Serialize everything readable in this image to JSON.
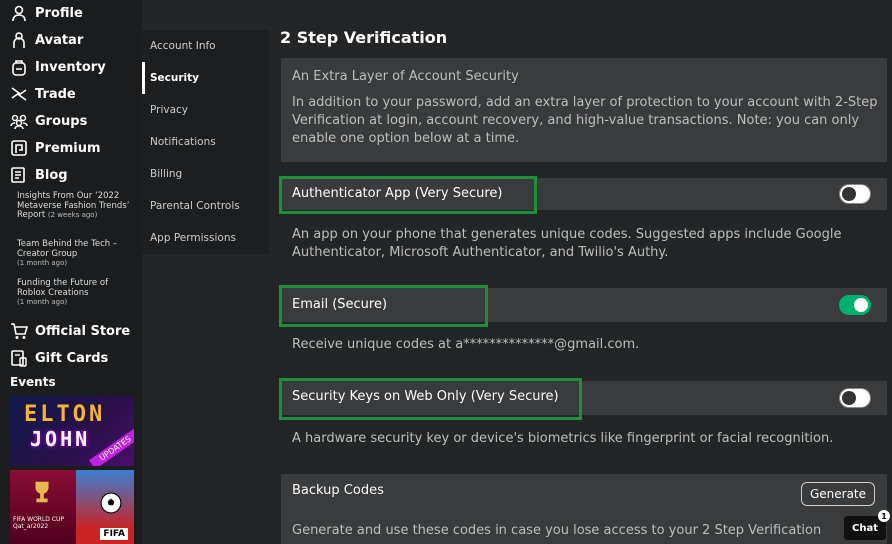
{
  "sidebar": {
    "items": [
      {
        "label": "Profile",
        "icon": "person-icon"
      },
      {
        "label": "Avatar",
        "icon": "avatar-icon"
      },
      {
        "label": "Inventory",
        "icon": "backpack-icon"
      },
      {
        "label": "Trade",
        "icon": "trade-icon"
      },
      {
        "label": "Groups",
        "icon": "groups-icon"
      },
      {
        "label": "Premium",
        "icon": "premium-icon"
      },
      {
        "label": "Blog",
        "icon": "blog-icon"
      }
    ],
    "blog_posts": [
      {
        "title": "Insights From Our ‘2022 Metaverse Fashion Trends’ Report",
        "date": "(2 weeks ago)"
      },
      {
        "title": "Team Behind the Tech – Creator Group",
        "date": "(1 month ago)"
      },
      {
        "title": "Funding the Future of Roblox Creations",
        "date": "(1 month ago)"
      }
    ],
    "store_items": [
      {
        "label": "Official Store",
        "icon": "cart-icon"
      },
      {
        "label": "Gift Cards",
        "icon": "gift-card-icon"
      }
    ],
    "events_label": "Events",
    "event1": {
      "line1": "ELTON",
      "line2": "JOHN",
      "ribbon": "UPDATES"
    },
    "event2": {
      "left_text": "FIFA WORLD CUP Qat_ar2022",
      "right_tag": "FIFA"
    }
  },
  "settings_menu": [
    {
      "label": "Account Info"
    },
    {
      "label": "Security",
      "active": true
    },
    {
      "label": "Privacy"
    },
    {
      "label": "Notifications"
    },
    {
      "label": "Billing"
    },
    {
      "label": "Parental Controls"
    },
    {
      "label": "App Permissions"
    }
  ],
  "main": {
    "title": "2 Step Verification",
    "intro_heading": "An Extra Layer of Account Security",
    "intro_text": "In addition to your password, add an extra layer of protection to your account with 2-Step Verification at login, account recovery, and high-value transactions. Note: you can only enable one option below at a time.",
    "options": [
      {
        "title": "Authenticator App (Very Secure)",
        "desc": "An app on your phone that generates unique codes. Suggested apps include Google Authenticator, Microsoft Authenticator, and Twilio's Authy.",
        "enabled": false
      },
      {
        "title": "Email (Secure)",
        "desc": "Receive unique codes at a**************@gmail.com.",
        "enabled": true
      },
      {
        "title": "Security Keys on Web Only (Very Secure)",
        "desc": "A hardware security key or device's biometrics like fingerprint or facial recognition.",
        "enabled": false
      }
    ],
    "backup": {
      "title": "Backup Codes",
      "button": "Generate",
      "desc": "Generate and use these codes in case you lose access to your 2 Step Verification"
    }
  },
  "chat": {
    "label": "Chat",
    "badge": "1"
  },
  "colors": {
    "accent_green": "#00b06f",
    "highlight_box": "#1f8f3a",
    "panel": "#393b3d",
    "background": "#232527"
  }
}
